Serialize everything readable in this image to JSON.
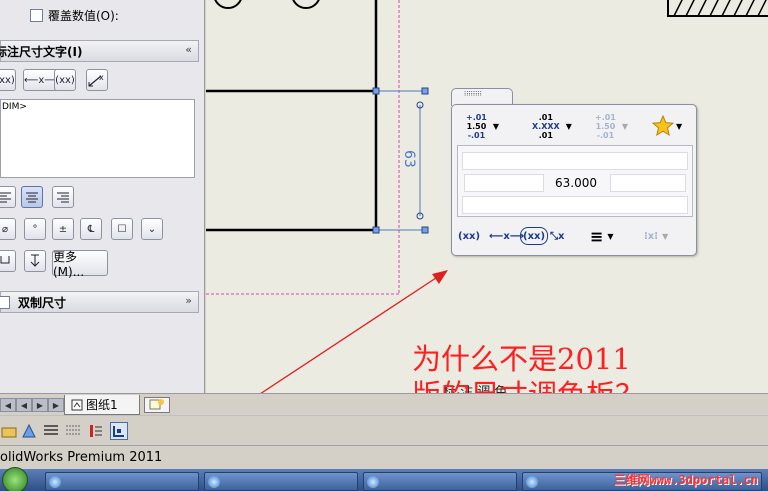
{
  "left_panel": {
    "override_values_label": "覆盖数值(O):",
    "dimension_text_header": "标注尺寸文字(I)",
    "dimension_text_chevron": "«",
    "dim_text_content": "DIM>",
    "buttons_row1": [
      "(xx)",
      "⟵x⟶",
      "(xx)",
      "x"
    ],
    "symbol_buttons": [
      "⌀",
      "°",
      "±",
      "℄",
      "☐",
      "⌄"
    ],
    "more_button_label": "更多(M)...",
    "dual_dimension_label": "双制尺寸",
    "dual_dimension_chevron": "»"
  },
  "sheet_tabs": {
    "active_tab_label": "图纸1"
  },
  "status_bar": {
    "text": "olidWorks Premium 2011"
  },
  "dimension_palette": {
    "tab_grip": "⁝⁝⁝⁝⁝⁝⁝⁝",
    "tolerance_buttons": [
      {
        "top": "+.01",
        "mid": "1.50",
        "bottom": "-.01",
        "enabled": true
      },
      {
        "top": ".01",
        "mid": "X.XXX",
        "bottom": ".01",
        "enabled": true
      },
      {
        "top": "+.01",
        "mid": "1.50",
        "bottom": "-.01",
        "enabled": false
      }
    ],
    "favorite_icon": "star-icon",
    "value": "63.000",
    "bottom_buttons": [
      "(xx)",
      "⟵x⟶",
      "(xx)",
      "⤡x",
      "≡",
      "⁝x⁝"
    ]
  },
  "drawing": {
    "dimension_text": "63",
    "sheet_border_color": "#d846b8"
  },
  "annotation": {
    "line1": "为什么不是2011",
    "line2": "版的尺寸调色板？",
    "color": "#ff1f1f",
    "behind_text": "标 注 调 色"
  },
  "taskbar": {
    "watermark": "三维网www.3dportal.cn"
  }
}
